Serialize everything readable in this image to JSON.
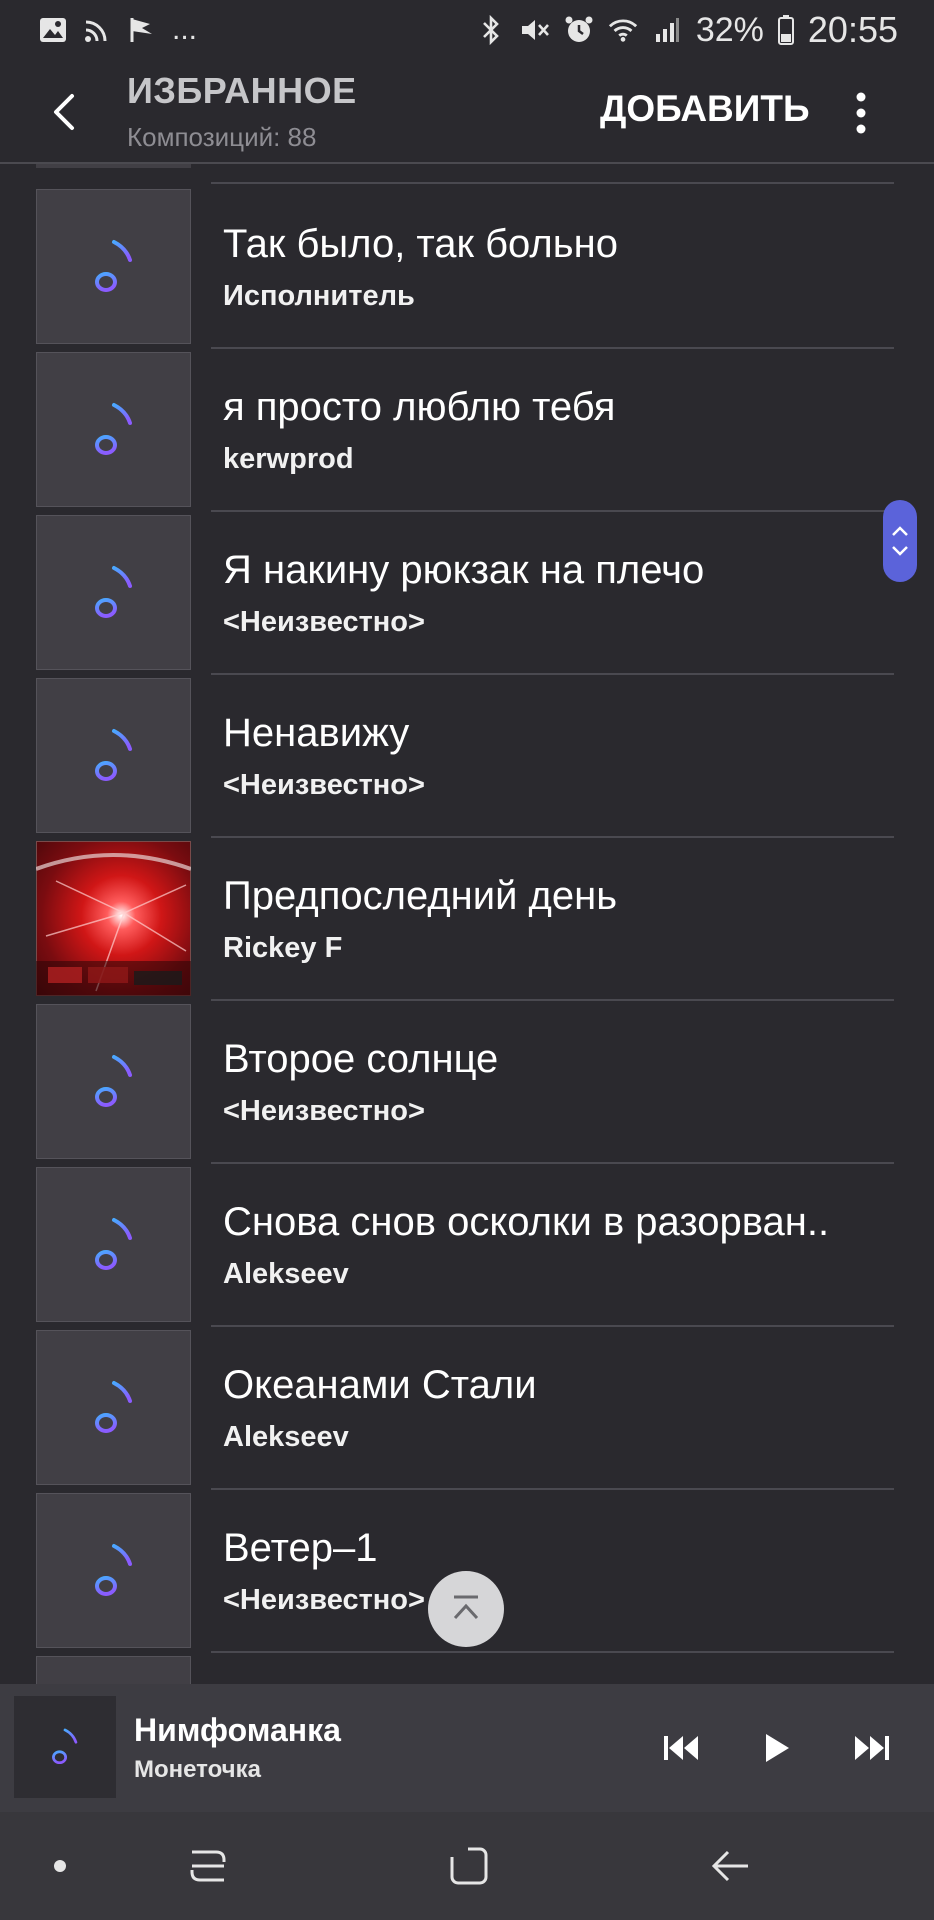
{
  "status_bar": {
    "more_indicator": "...",
    "battery": "32%",
    "time": "20:55",
    "icons_left": [
      "gallery-icon",
      "cast-icon",
      "flag-icon"
    ],
    "icons_right": [
      "bluetooth-icon",
      "mute-icon",
      "alarm-icon",
      "wifi-icon",
      "signal-icon",
      "battery-icon"
    ]
  },
  "header": {
    "title": "ИЗБРАННОЕ",
    "subtitle": "Композиций: 88",
    "add_label": "ДОБАВИТЬ"
  },
  "songs": [
    {
      "title": "Так было, так больно",
      "artist": "Исполнитель",
      "thumb": "music-note-icon"
    },
    {
      "title": "я просто люблю тебя",
      "artist": "kerwprod",
      "thumb": "music-note-icon"
    },
    {
      "title": "Я накину рюкзак на плечо",
      "artist": "<Неизвестно>",
      "thumb": "music-note-icon"
    },
    {
      "title": "Ненавижу",
      "artist": "<Неизвестно>",
      "thumb": "music-note-icon"
    },
    {
      "title": "Предпоследний день",
      "artist": "Rickey F",
      "thumb": "album-art"
    },
    {
      "title": "Второе солнце",
      "artist": "<Неизвестно>",
      "thumb": "music-note-icon"
    },
    {
      "title": "Снова снов осколки в разорван..",
      "artist": "Alekseev",
      "thumb": "music-note-icon"
    },
    {
      "title": "Океанами Стали",
      "artist": "Alekseev",
      "thumb": "music-note-icon"
    },
    {
      "title": "Ветер–1",
      "artist": "<Неизвестно>",
      "thumb": "music-note-icon"
    }
  ],
  "now_playing": {
    "title": "Нимфоманка",
    "artist": "Монеточка"
  },
  "colors": {
    "background": "#2a292e",
    "accent": "#5b63da",
    "note_gradient_start": "#4aa8ff",
    "note_gradient_end": "#8a5cff"
  }
}
